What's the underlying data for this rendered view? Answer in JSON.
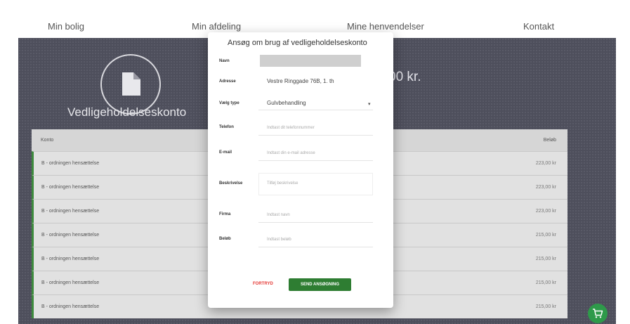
{
  "nav": {
    "items": [
      {
        "label": "Min bolig"
      },
      {
        "label": "Min afdeling"
      },
      {
        "label": "Mine henvendelser"
      },
      {
        "label": "Kontakt"
      }
    ]
  },
  "hero": {
    "title": "Vedligeholdelseskonto",
    "amount": "00 kr.",
    "icon": "document-icon"
  },
  "table": {
    "columns": [
      "Konto",
      "Beløb"
    ],
    "rows": [
      {
        "konto": "B - ordningen hensættelse",
        "belob": "223,00 kr"
      },
      {
        "konto": "B - ordningen hensættelse",
        "belob": "223,00 kr"
      },
      {
        "konto": "B - ordningen hensættelse",
        "belob": "223,00 kr"
      },
      {
        "konto": "B - ordningen hensættelse",
        "belob": "215,00 kr"
      },
      {
        "konto": "B - ordningen hensættelse",
        "belob": "215,00 kr"
      },
      {
        "konto": "B - ordningen hensættelse",
        "belob": "215,00 kr"
      },
      {
        "konto": "B - ordningen hensættelse",
        "belob": "215,00 kr"
      }
    ]
  },
  "modal": {
    "title": "Ansøg om brug af vedligeholdelseskonto",
    "fields": {
      "navn": {
        "label": "Navn"
      },
      "adresse": {
        "label": "Adresse",
        "value": "Vestre Ringgade 76B, 1. th"
      },
      "type": {
        "label": "Vælg type",
        "value": "Gulvbehandling"
      },
      "telefon": {
        "label": "Telefon",
        "placeholder": "Indtast dit telefonnummer"
      },
      "email": {
        "label": "E-mail",
        "placeholder": "Indtast din e-mail adresse"
      },
      "beskrivelse": {
        "label": "Beskrivelse",
        "placeholder": "Tilføj beskrivelse"
      },
      "firma": {
        "label": "Firma",
        "placeholder": "Indtast navn"
      },
      "belob": {
        "label": "Beløb",
        "placeholder": "Indtast beløb"
      }
    },
    "cancel_label": "FORTRYD",
    "send_label": "SEND ANSØGNING"
  },
  "fab": {
    "icon": "cart-icon"
  },
  "colors": {
    "accent": "#2e7d32",
    "danger": "#e53935",
    "hero_bg": "#4e4f5c"
  }
}
